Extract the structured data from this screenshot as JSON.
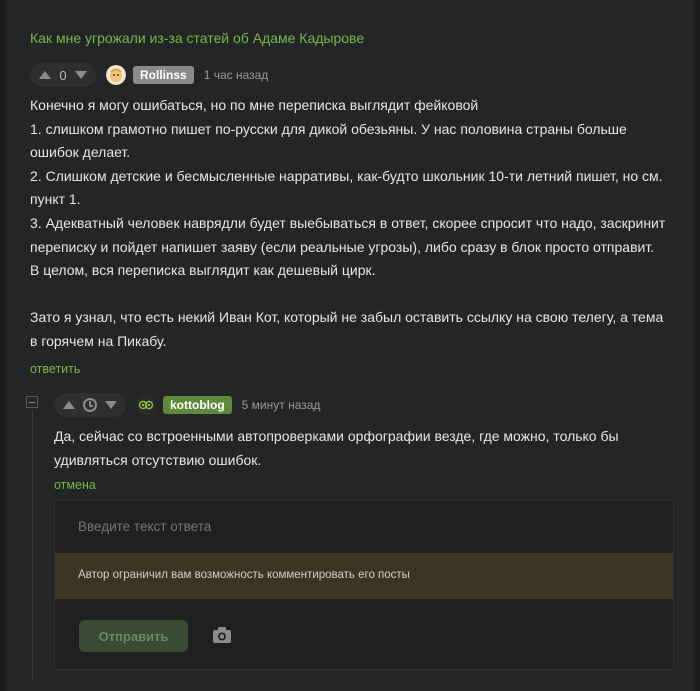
{
  "post": {
    "title": "Как мне угрожали из-за статей об Адаме Кадырове"
  },
  "comment1": {
    "score": "0",
    "username": "Rollinss",
    "username_badge_color": "#8a8a8a",
    "timestamp": "1 час назад",
    "lines": [
      "Конечно я могу ошибаться, но по мне переписка выглядит фейковой",
      "1. слишком грамотно пишет по-русски для дикой обезьяны. У нас половина страны больше",
      "ошибок делает.",
      "2. Слишком детские и бесмысленные нарративы, как-будто школьник 10-ти летний пишет, но см.",
      "пункт 1.",
      "3. Адекватный человек наврядли будет выебываться в ответ, скорее спросит что надо, заскринит",
      "переписку и пойдет напишет заяву (если реальные угрозы), либо сразу в блок просто отправит.",
      "В целом, вся переписка выглядит как дешевый цирк.",
      "",
      "Зато я узнал, что есть некий Иван Кот, который не забыл оставить ссылку на свою телегу, а тема",
      "в горячем на Пикабу."
    ],
    "reply_label": "ответить"
  },
  "comment2": {
    "username": "kottoblog",
    "username_badge_color": "#5f8a3c",
    "timestamp": "5 минут назад",
    "lines": [
      "Да, сейчас со встроенными автопроверками орфографии везде, где можно, только бы",
      "удивляться отсутствию ошибок."
    ],
    "cancel_label": "отмена"
  },
  "reply_form": {
    "placeholder": "Введите текст ответа",
    "restriction_notice": "Автор ограничил вам возможность комментировать его посты",
    "send_label": "Отправить"
  },
  "colors": {
    "accent_green": "#77b849",
    "background": "#242526",
    "warning_bg": "#3b3621"
  }
}
